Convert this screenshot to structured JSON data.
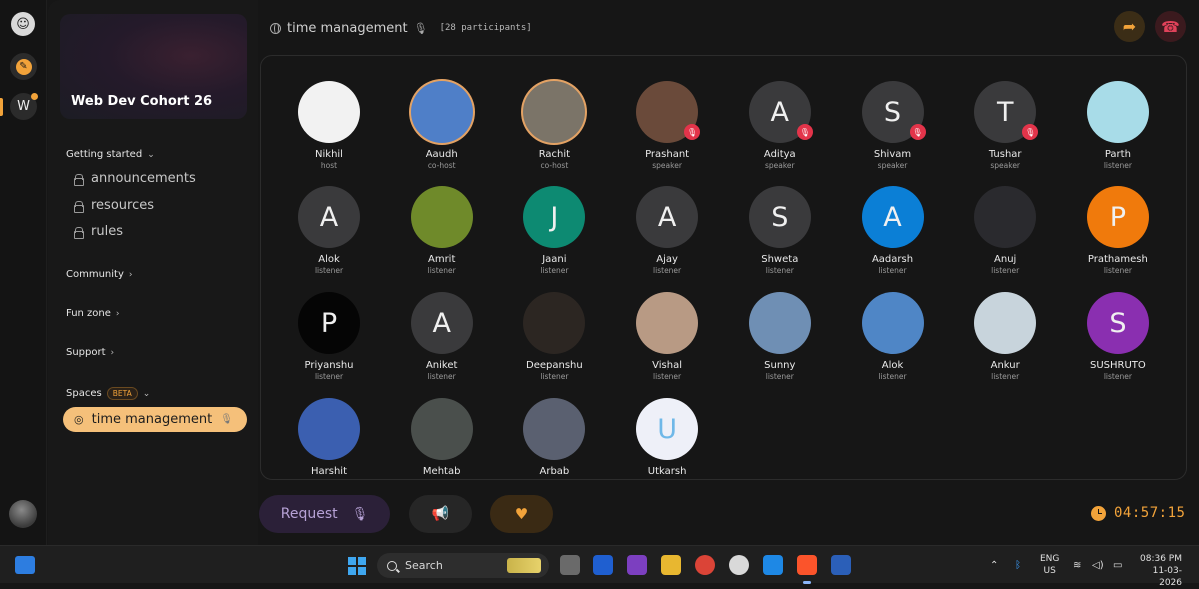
{
  "workspace": {
    "banner_title": "Web Dev Cohort 26",
    "rail_initial": "W"
  },
  "sidebar": {
    "getting_started": "Getting started",
    "channels": [
      "announcements",
      "resources",
      "rules"
    ],
    "community": "Community",
    "fun_zone": "Fun zone",
    "support": "Support",
    "spaces": "Spaces",
    "beta_badge": "BETA",
    "active_space": "time management"
  },
  "header": {
    "title": "time management",
    "participants": "[28 participants]"
  },
  "participants": [
    {
      "name": "Nikhil",
      "role": "host",
      "initial": "",
      "color": "#f2f2f2",
      "ring": false,
      "muted": false
    },
    {
      "name": "Aaudh",
      "role": "co-host",
      "initial": "",
      "color": "#4f7fc8",
      "ring": true,
      "muted": false
    },
    {
      "name": "Rachit",
      "role": "co-host",
      "initial": "",
      "color": "#7b7468",
      "ring": true,
      "muted": false
    },
    {
      "name": "Prashant",
      "role": "speaker",
      "initial": "",
      "color": "#6a4a3a",
      "ring": false,
      "muted": true
    },
    {
      "name": "Aditya",
      "role": "speaker",
      "initial": "A",
      "color": "#3a3a3c",
      "ring": false,
      "muted": true
    },
    {
      "name": "Shivam",
      "role": "speaker",
      "initial": "S",
      "color": "#3a3a3c",
      "ring": false,
      "muted": true
    },
    {
      "name": "Tushar",
      "role": "speaker",
      "initial": "T",
      "color": "#3a3a3c",
      "ring": false,
      "muted": true
    },
    {
      "name": "Parth",
      "role": "listener",
      "initial": "",
      "color": "#a8dce8",
      "ring": false,
      "muted": false
    },
    {
      "name": "Alok",
      "role": "listener",
      "initial": "A",
      "color": "#3a3a3c",
      "ring": false,
      "muted": false
    },
    {
      "name": "Amrit",
      "role": "listener",
      "initial": "",
      "color": "#6f8a2a",
      "ring": false,
      "muted": false
    },
    {
      "name": "Jaani",
      "role": "listener",
      "initial": "J",
      "color": "#0d8a72",
      "ring": false,
      "muted": false
    },
    {
      "name": "Ajay",
      "role": "listener",
      "initial": "A",
      "color": "#3a3a3c",
      "ring": false,
      "muted": false
    },
    {
      "name": "Shweta",
      "role": "listener",
      "initial": "S",
      "color": "#3a3a3c",
      "ring": false,
      "muted": false
    },
    {
      "name": "Aadarsh",
      "role": "listener",
      "initial": "A",
      "color": "#0b7fd6",
      "ring": false,
      "muted": false
    },
    {
      "name": "Anuj",
      "role": "listener",
      "initial": "",
      "color": "#2a2a2e",
      "ring": false,
      "muted": false
    },
    {
      "name": "Prathamesh",
      "role": "listener",
      "initial": "P",
      "color": "#f07a0c",
      "ring": false,
      "muted": false
    },
    {
      "name": "Priyanshu",
      "role": "listener",
      "initial": "P",
      "color": "#050505",
      "ring": false,
      "muted": false
    },
    {
      "name": "Aniket",
      "role": "listener",
      "initial": "A",
      "color": "#3a3a3c",
      "ring": false,
      "muted": false
    },
    {
      "name": "Deepanshu",
      "role": "listener",
      "initial": "",
      "color": "#2c2622",
      "ring": false,
      "muted": false
    },
    {
      "name": "Vishal",
      "role": "listener",
      "initial": "",
      "color": "#b89a84",
      "ring": false,
      "muted": false
    },
    {
      "name": "Sunny",
      "role": "listener",
      "initial": "",
      "color": "#6f8fb4",
      "ring": false,
      "muted": false
    },
    {
      "name": "Alok",
      "role": "listener",
      "initial": "",
      "color": "#4f86c6",
      "ring": false,
      "muted": false
    },
    {
      "name": "Ankur",
      "role": "listener",
      "initial": "",
      "color": "#c8d4dc",
      "ring": false,
      "muted": false
    },
    {
      "name": "SUSHRUTO",
      "role": "listener",
      "initial": "S",
      "color": "#8a2fb0",
      "ring": false,
      "muted": false
    },
    {
      "name": "Harshit",
      "role": "",
      "initial": "",
      "color": "#3b5fb0",
      "ring": false,
      "muted": false
    },
    {
      "name": "Mehtab",
      "role": "",
      "initial": "",
      "color": "#4a4f4c",
      "ring": false,
      "muted": false
    },
    {
      "name": "Arbab",
      "role": "",
      "initial": "",
      "color": "#5a6070",
      "ring": false,
      "muted": false
    },
    {
      "name": "Utkarsh",
      "role": "",
      "initial": "U",
      "color": "#eef0f8",
      "ring": false,
      "muted": false
    }
  ],
  "controls": {
    "request_label": "Request",
    "timer": "04:57:15"
  },
  "taskbar": {
    "search_label": "Search",
    "lang_line1": "ENG",
    "lang_line2": "US",
    "time": "08:36 PM",
    "date": "11-03-2026"
  }
}
